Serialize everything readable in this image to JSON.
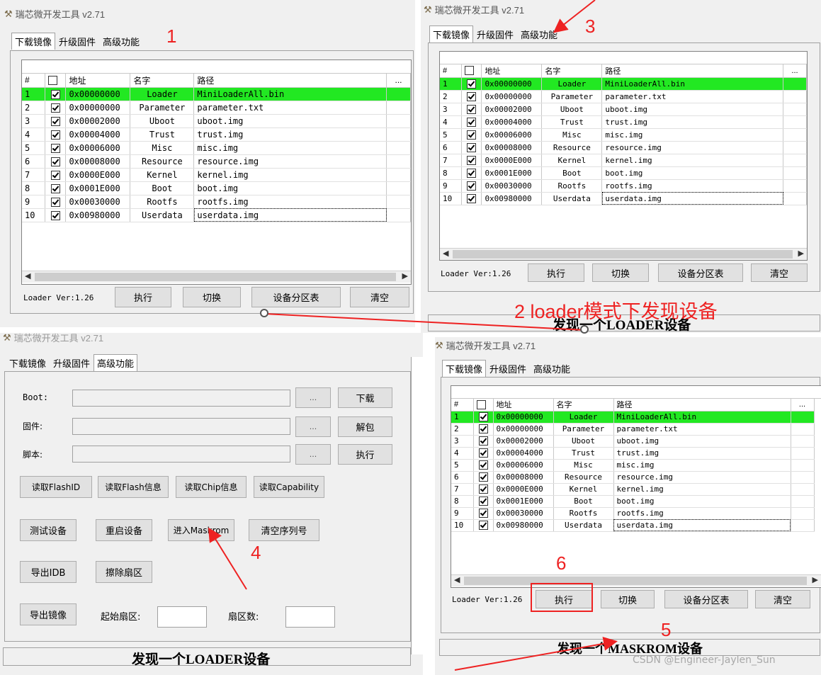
{
  "window_title": "瑞芯微开发工具 v2.71",
  "tabs": [
    "下载镜像",
    "升级固件",
    "高级功能"
  ],
  "table_headers": [
    "#",
    "",
    "地址",
    "名字",
    "路径",
    "..."
  ],
  "rows": [
    {
      "n": "1",
      "addr": "0x00000000",
      "name": "Loader",
      "path": "MiniLoaderAll.bin"
    },
    {
      "n": "2",
      "addr": "0x00000000",
      "name": "Parameter",
      "path": "parameter.txt"
    },
    {
      "n": "3",
      "addr": "0x00002000",
      "name": "Uboot",
      "path": "uboot.img"
    },
    {
      "n": "4",
      "addr": "0x00004000",
      "name": "Trust",
      "path": "trust.img"
    },
    {
      "n": "5",
      "addr": "0x00006000",
      "name": "Misc",
      "path": "misc.img"
    },
    {
      "n": "6",
      "addr": "0x00008000",
      "name": "Resource",
      "path": "resource.img"
    },
    {
      "n": "7",
      "addr": "0x0000E000",
      "name": "Kernel",
      "path": "kernel.img"
    },
    {
      "n": "8",
      "addr": "0x0001E000",
      "name": "Boot",
      "path": "boot.img"
    },
    {
      "n": "9",
      "addr": "0x00030000",
      "name": "Rootfs",
      "path": "rootfs.img"
    },
    {
      "n": "10",
      "addr": "0x00980000",
      "name": "Userdata",
      "path": "userdata.img"
    }
  ],
  "loader_ver": "Loader Ver:1.26",
  "buttons": {
    "exec": "执行",
    "switch": "切换",
    "partition": "设备分区表",
    "clear": "清空"
  },
  "status_loader": "发现一个LOADER设备",
  "status_maskrom": "发现一个MASKROM设备",
  "advanced": {
    "boot_label": "Boot:",
    "firmware_label": "固件:",
    "script_label": "脚本:",
    "browse": "...",
    "download": "下载",
    "unpack": "解包",
    "execute": "执行",
    "read_flashid": "读取FlashID",
    "read_flash_info": "读取Flash信息",
    "read_chip_info": "读取Chip信息",
    "read_capability": "读取Capability",
    "test_device": "测试设备",
    "reboot_device": "重启设备",
    "enter_maskrom": "进入Maskrom",
    "clear_serial": "清空序列号",
    "export_idb": "导出IDB",
    "erase_sector": "擦除扇区",
    "export_image": "导出镜像",
    "start_sector": "起始扇区:",
    "sector_count": "扇区数:"
  },
  "annotations": {
    "a1": "1",
    "a2": "2 loader模式下发现设备",
    "a3": "3",
    "a4": "4",
    "a5": "5",
    "a6": "6"
  },
  "watermark": "CSDN @Engineer-Jaylen_Sun",
  "colors": {
    "selected_row": "#22e822",
    "annotation": "#ee2222"
  }
}
